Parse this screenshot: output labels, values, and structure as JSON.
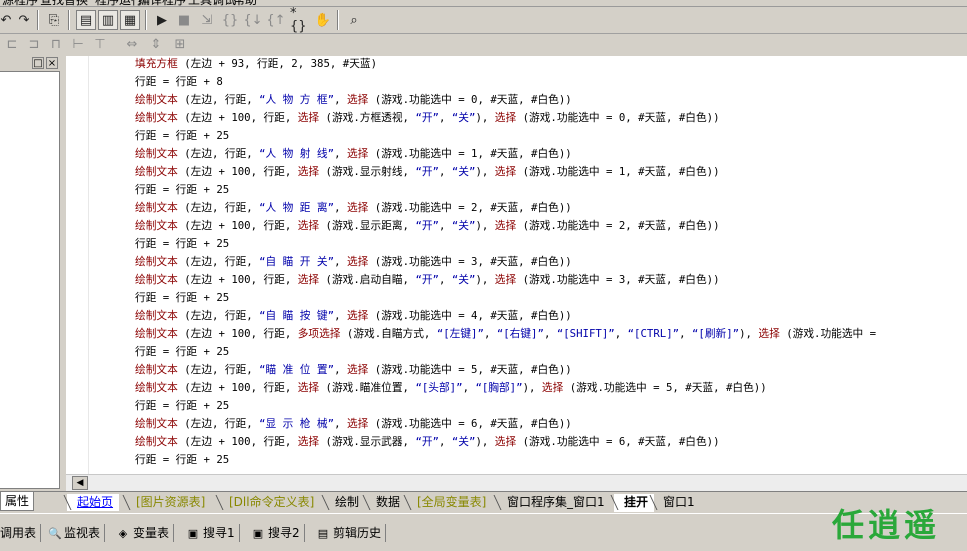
{
  "menubar": {
    "items": [
      "源程序",
      "查找替换",
      "程序运行",
      "编译程序",
      "工具调试",
      "帮助"
    ]
  },
  "toolbar1": {
    "buttons": [
      {
        "name": "undo-icon",
        "glyph": "↶"
      },
      {
        "name": "redo-icon",
        "glyph": "↷"
      },
      {
        "name": "find-icon",
        "glyph": "⎘"
      },
      {
        "name": "layout-1-icon",
        "glyph": "▤"
      },
      {
        "name": "layout-2-icon",
        "glyph": "▥"
      },
      {
        "name": "layout-3-icon",
        "glyph": "▦"
      },
      {
        "name": "run-icon",
        "glyph": "▶"
      },
      {
        "name": "stop-icon",
        "glyph": "■"
      },
      {
        "name": "step-icon",
        "glyph": "⇲"
      },
      {
        "name": "step-into-icon",
        "glyph": "{}"
      },
      {
        "name": "step-over-icon",
        "glyph": "{↓"
      },
      {
        "name": "step-out-icon",
        "glyph": "{↑"
      },
      {
        "name": "breakpoint-icon",
        "glyph": "*{}"
      },
      {
        "name": "hand-icon",
        "glyph": "✋"
      },
      {
        "name": "binoculars-icon",
        "glyph": "⌕"
      }
    ]
  },
  "toolbar2": {
    "buttons": [
      "align-left-icon",
      "align-center-icon",
      "align-right-icon",
      "space-h-icon",
      "space-v-icon",
      "same-width-icon",
      "same-height-icon",
      "same-size-icon"
    ]
  },
  "left_panel": {
    "pin_label": "□",
    "close_label": "×"
  },
  "code_lines": [
    [
      {
        "c": "f",
        "t": "填充方框"
      },
      {
        "c": "k",
        "t": " (左边 + 93, 行距, 2, 385, #天蓝)"
      }
    ],
    [
      {
        "c": "k",
        "t": "行距 = 行距 + 8"
      }
    ],
    [
      {
        "c": "f",
        "t": "绘制文本"
      },
      {
        "c": "k",
        "t": " (左边, 行距, "
      },
      {
        "c": "s",
        "t": "“人 物 方 框”"
      },
      {
        "c": "k",
        "t": ", "
      },
      {
        "c": "f",
        "t": "选择"
      },
      {
        "c": "k",
        "t": " (游戏.功能选中 = 0, #天蓝, #白色))"
      }
    ],
    [
      {
        "c": "f",
        "t": "绘制文本"
      },
      {
        "c": "k",
        "t": " (左边 + 100, 行距, "
      },
      {
        "c": "f",
        "t": "选择"
      },
      {
        "c": "k",
        "t": " (游戏.方框透视, "
      },
      {
        "c": "s",
        "t": "“开”"
      },
      {
        "c": "k",
        "t": ", "
      },
      {
        "c": "s",
        "t": "“关”"
      },
      {
        "c": "k",
        "t": "), "
      },
      {
        "c": "f",
        "t": "选择"
      },
      {
        "c": "k",
        "t": " (游戏.功能选中 = 0, #天蓝, #白色))"
      }
    ],
    [
      {
        "c": "k",
        "t": "行距 = 行距 + 25"
      }
    ],
    [
      {
        "c": "f",
        "t": "绘制文本"
      },
      {
        "c": "k",
        "t": " (左边, 行距, "
      },
      {
        "c": "s",
        "t": "“人 物 射 线”"
      },
      {
        "c": "k",
        "t": ", "
      },
      {
        "c": "f",
        "t": "选择"
      },
      {
        "c": "k",
        "t": " (游戏.功能选中 = 1, #天蓝, #白色))"
      }
    ],
    [
      {
        "c": "f",
        "t": "绘制文本"
      },
      {
        "c": "k",
        "t": " (左边 + 100, 行距, "
      },
      {
        "c": "f",
        "t": "选择"
      },
      {
        "c": "k",
        "t": " (游戏.显示射线, "
      },
      {
        "c": "s",
        "t": "“开”"
      },
      {
        "c": "k",
        "t": ", "
      },
      {
        "c": "s",
        "t": "“关”"
      },
      {
        "c": "k",
        "t": "), "
      },
      {
        "c": "f",
        "t": "选择"
      },
      {
        "c": "k",
        "t": " (游戏.功能选中 = 1, #天蓝, #白色))"
      }
    ],
    [
      {
        "c": "k",
        "t": "行距 = 行距 + 25"
      }
    ],
    [
      {
        "c": "f",
        "t": "绘制文本"
      },
      {
        "c": "k",
        "t": " (左边, 行距, "
      },
      {
        "c": "s",
        "t": "“人 物 距 离”"
      },
      {
        "c": "k",
        "t": ", "
      },
      {
        "c": "f",
        "t": "选择"
      },
      {
        "c": "k",
        "t": " (游戏.功能选中 = 2, #天蓝, #白色))"
      }
    ],
    [
      {
        "c": "f",
        "t": "绘制文本"
      },
      {
        "c": "k",
        "t": " (左边 + 100, 行距, "
      },
      {
        "c": "f",
        "t": "选择"
      },
      {
        "c": "k",
        "t": " (游戏.显示距离, "
      },
      {
        "c": "s",
        "t": "“开”"
      },
      {
        "c": "k",
        "t": ", "
      },
      {
        "c": "s",
        "t": "“关”"
      },
      {
        "c": "k",
        "t": "), "
      },
      {
        "c": "f",
        "t": "选择"
      },
      {
        "c": "k",
        "t": " (游戏.功能选中 = 2, #天蓝, #白色))"
      }
    ],
    [
      {
        "c": "k",
        "t": "行距 = 行距 + 25"
      }
    ],
    [
      {
        "c": "f",
        "t": "绘制文本"
      },
      {
        "c": "k",
        "t": " (左边, 行距, "
      },
      {
        "c": "s",
        "t": "“自 瞄 开 关”"
      },
      {
        "c": "k",
        "t": ", "
      },
      {
        "c": "f",
        "t": "选择"
      },
      {
        "c": "k",
        "t": " (游戏.功能选中 = 3, #天蓝, #白色))"
      }
    ],
    [
      {
        "c": "f",
        "t": "绘制文本"
      },
      {
        "c": "k",
        "t": " (左边 + 100, 行距, "
      },
      {
        "c": "f",
        "t": "选择"
      },
      {
        "c": "k",
        "t": " (游戏.启动自瞄, "
      },
      {
        "c": "s",
        "t": "“开”"
      },
      {
        "c": "k",
        "t": ", "
      },
      {
        "c": "s",
        "t": "“关”"
      },
      {
        "c": "k",
        "t": "), "
      },
      {
        "c": "f",
        "t": "选择"
      },
      {
        "c": "k",
        "t": " (游戏.功能选中 = 3, #天蓝, #白色))"
      }
    ],
    [
      {
        "c": "k",
        "t": "行距 = 行距 + 25"
      }
    ],
    [
      {
        "c": "f",
        "t": "绘制文本"
      },
      {
        "c": "k",
        "t": " (左边, 行距, "
      },
      {
        "c": "s",
        "t": "“自 瞄 按 键”"
      },
      {
        "c": "k",
        "t": ", "
      },
      {
        "c": "f",
        "t": "选择"
      },
      {
        "c": "k",
        "t": " (游戏.功能选中 = 4, #天蓝, #白色))"
      }
    ],
    [
      {
        "c": "f",
        "t": "绘制文本"
      },
      {
        "c": "k",
        "t": " (左边 + 100, 行距, "
      },
      {
        "c": "f",
        "t": "多项选择"
      },
      {
        "c": "k",
        "t": " (游戏.自瞄方式, "
      },
      {
        "c": "s",
        "t": "“[左键]”"
      },
      {
        "c": "k",
        "t": ", "
      },
      {
        "c": "s",
        "t": "“[右键]”"
      },
      {
        "c": "k",
        "t": ", "
      },
      {
        "c": "s",
        "t": "“[SHIFT]”"
      },
      {
        "c": "k",
        "t": ", "
      },
      {
        "c": "s",
        "t": "“[CTRL]”"
      },
      {
        "c": "k",
        "t": ", "
      },
      {
        "c": "s",
        "t": "“[刷新]”"
      },
      {
        "c": "k",
        "t": "), "
      },
      {
        "c": "f",
        "t": "选择"
      },
      {
        "c": "k",
        "t": " (游戏.功能选中 = "
      }
    ],
    [
      {
        "c": "k",
        "t": "行距 = 行距 + 25"
      }
    ],
    [
      {
        "c": "f",
        "t": "绘制文本"
      },
      {
        "c": "k",
        "t": " (左边, 行距, "
      },
      {
        "c": "s",
        "t": "“瞄 准 位 置”"
      },
      {
        "c": "k",
        "t": ", "
      },
      {
        "c": "f",
        "t": "选择"
      },
      {
        "c": "k",
        "t": " (游戏.功能选中 = 5, #天蓝, #白色))"
      }
    ],
    [
      {
        "c": "f",
        "t": "绘制文本"
      },
      {
        "c": "k",
        "t": " (左边 + 100, 行距, "
      },
      {
        "c": "f",
        "t": "选择"
      },
      {
        "c": "k",
        "t": " (游戏.瞄准位置, "
      },
      {
        "c": "s",
        "t": "“[头部]”"
      },
      {
        "c": "k",
        "t": ", "
      },
      {
        "c": "s",
        "t": "“[胸部]”"
      },
      {
        "c": "k",
        "t": "), "
      },
      {
        "c": "f",
        "t": "选择"
      },
      {
        "c": "k",
        "t": " (游戏.功能选中 = 5, #天蓝, #白色))"
      }
    ],
    [
      {
        "c": "k",
        "t": "行距 = 行距 + 25"
      }
    ],
    [
      {
        "c": "f",
        "t": "绘制文本"
      },
      {
        "c": "k",
        "t": " (左边, 行距, "
      },
      {
        "c": "s",
        "t": "“显 示 枪 械”"
      },
      {
        "c": "k",
        "t": ", "
      },
      {
        "c": "f",
        "t": "选择"
      },
      {
        "c": "k",
        "t": " (游戏.功能选中 = 6, #天蓝, #白色))"
      }
    ],
    [
      {
        "c": "f",
        "t": "绘制文本"
      },
      {
        "c": "k",
        "t": " (左边 + 100, 行距, "
      },
      {
        "c": "f",
        "t": "选择"
      },
      {
        "c": "k",
        "t": " (游戏.显示武器, "
      },
      {
        "c": "s",
        "t": "“开”"
      },
      {
        "c": "k",
        "t": ", "
      },
      {
        "c": "s",
        "t": "“关”"
      },
      {
        "c": "k",
        "t": "), "
      },
      {
        "c": "f",
        "t": "选择"
      },
      {
        "c": "k",
        "t": " (游戏.功能选中 = 6, #天蓝, #白色))"
      }
    ],
    [
      {
        "c": "k",
        "t": "行距 = 行距 + 25"
      }
    ]
  ],
  "property_tab": "属性",
  "editor_tabs": [
    "起始页",
    "[图片资源表]",
    "[Dll命令定义表]",
    "绘制",
    "数据",
    "[全局变量表]",
    "窗口程序集_窗口1",
    "挂开",
    "窗口1"
  ],
  "active_editor_tab": 7,
  "bottom_tabs": [
    {
      "icon": "call-stack-icon",
      "glyph": "",
      "label": "调用表"
    },
    {
      "icon": "magnifier-icon",
      "glyph": "🔍",
      "label": "监视表"
    },
    {
      "icon": "variables-icon",
      "glyph": "◈",
      "label": "变量表"
    },
    {
      "icon": "search1-icon",
      "glyph": "▣",
      "label": "搜寻1"
    },
    {
      "icon": "search2-icon",
      "glyph": "▣",
      "label": "搜寻2"
    },
    {
      "icon": "clipboard-icon",
      "glyph": "▤",
      "label": "剪辑历史"
    }
  ],
  "watermark": "任逍遥",
  "colors": {
    "function": "#8b0000",
    "string": "#0000aa",
    "watermark": "#2aa83a"
  }
}
